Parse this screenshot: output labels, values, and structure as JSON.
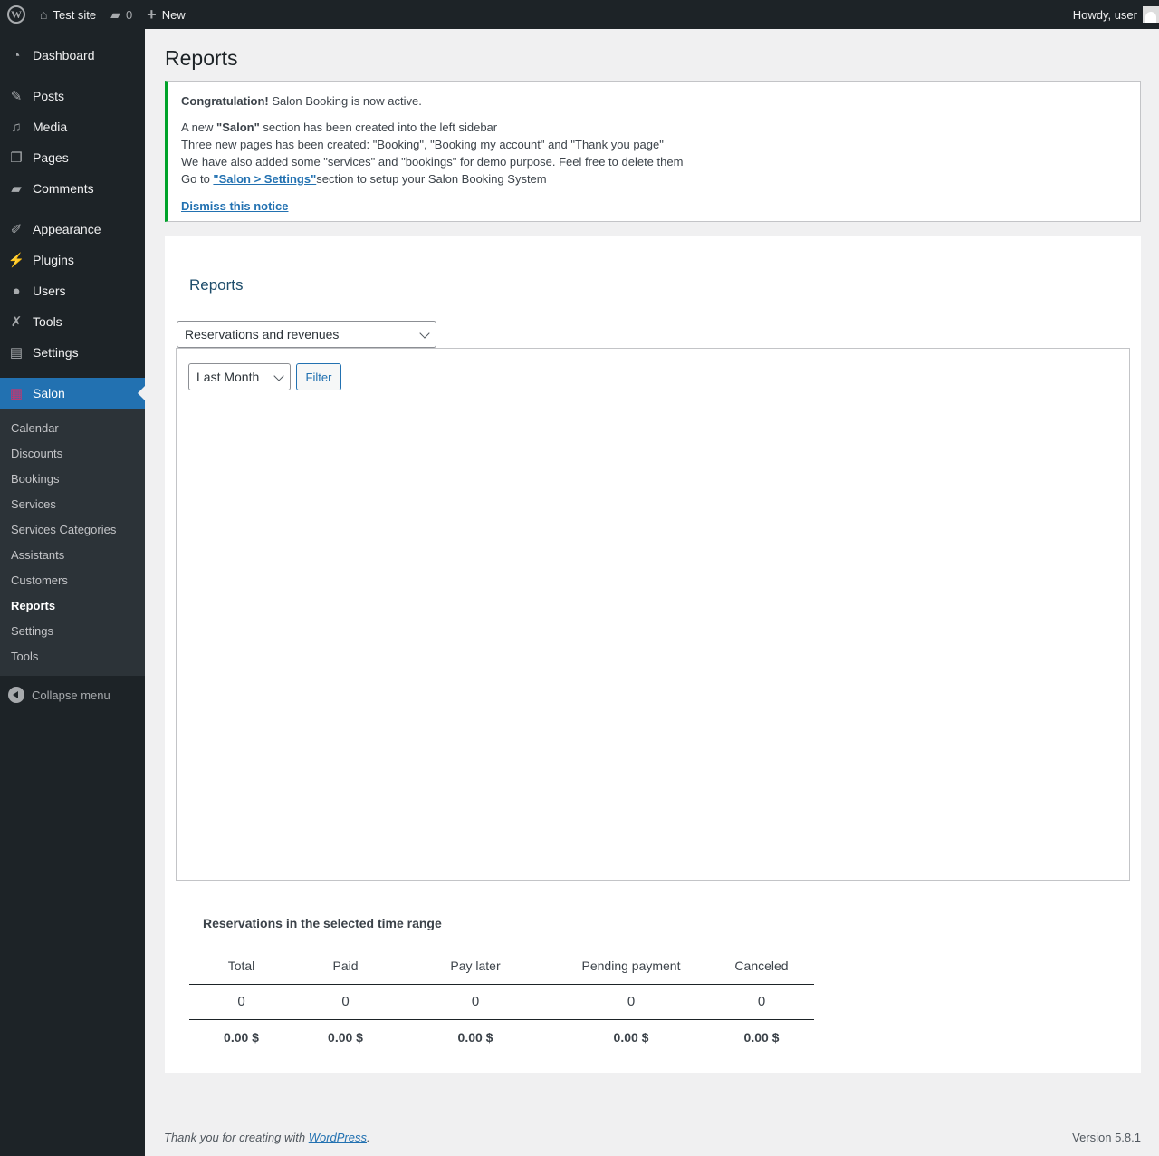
{
  "adminbar": {
    "site_name": "Test site",
    "comment_count": "0",
    "new_label": "New",
    "howdy": "Howdy, user"
  },
  "sidebar": {
    "items": [
      {
        "label": "Dashboard",
        "icon": "dashboard-icon"
      },
      {
        "label": "Posts",
        "icon": "pin-icon"
      },
      {
        "label": "Media",
        "icon": "media-icon"
      },
      {
        "label": "Pages",
        "icon": "pages-icon"
      },
      {
        "label": "Comments",
        "icon": "comment-icon"
      },
      {
        "label": "Appearance",
        "icon": "brush-icon"
      },
      {
        "label": "Plugins",
        "icon": "plug-icon"
      },
      {
        "label": "Users",
        "icon": "user-icon"
      },
      {
        "label": "Tools",
        "icon": "wrench-icon"
      },
      {
        "label": "Settings",
        "icon": "settings-icon"
      },
      {
        "label": "Salon",
        "icon": "calendar-icon"
      }
    ],
    "submenu": [
      "Calendar",
      "Discounts",
      "Bookings",
      "Services",
      "Services Categories",
      "Assistants",
      "Customers",
      "Reports",
      "Settings",
      "Tools"
    ],
    "collapse_label": "Collapse menu"
  },
  "page": {
    "title": "Reports"
  },
  "notice": {
    "strong": "Congratulation!",
    "line1_rest": " Salon Booking is now active.",
    "line2_pre": "A new ",
    "line2_strong": "\"Salon\"",
    "line2_post": " section has been created into the left sidebar",
    "line3": "Three new pages has been created: \"Booking\", \"Booking my account\" and \"Thank you page\"",
    "line4": "We have also added some \"services\" and \"bookings\" for demo purpose. Feel free to delete them",
    "line5_pre": "Go to ",
    "line5_link": "\"Salon > Settings\"",
    "line5_post": "section to setup your Salon Booking System",
    "dismiss": "Dismiss this notice"
  },
  "reports": {
    "heading": "Reports",
    "report_type": "Reservations and revenues",
    "range": "Last Month",
    "filter_label": "Filter",
    "table_title": "Reservations in the selected time range",
    "columns": [
      "Total",
      "Paid",
      "Pay later",
      "Pending payment",
      "Canceled"
    ],
    "counts": [
      "0",
      "0",
      "0",
      "0",
      "0"
    ],
    "amounts": [
      "0.00 $",
      "0.00 $",
      "0.00 $",
      "0.00 $",
      "0.00 $"
    ]
  },
  "footer": {
    "thanks_pre": "Thank you for creating with ",
    "thanks_link": "WordPress",
    "thanks_post": ".",
    "version": "Version 5.8.1"
  },
  "colors": {
    "adminbar_bg": "#1d2327",
    "accent": "#2271b1",
    "notice_success": "#00a32a"
  }
}
